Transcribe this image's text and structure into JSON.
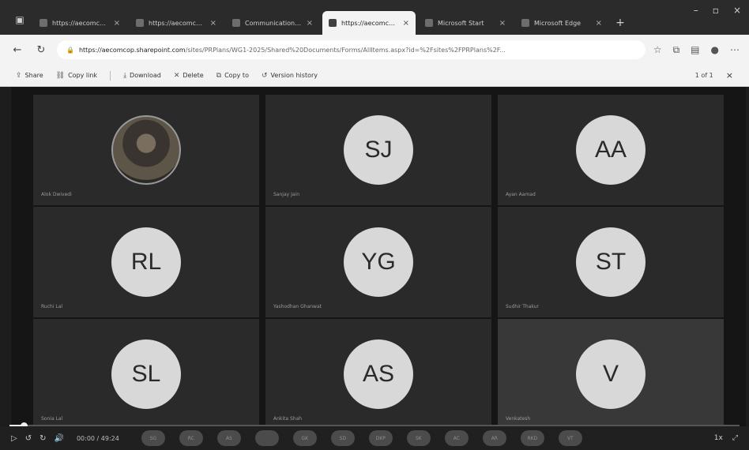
{
  "tabs": [
    {
      "label": "https://aecomcop.sharep",
      "active": false
    },
    {
      "label": "https://aecomcop.sharep",
      "active": false
    },
    {
      "label": "Communication site - Ur",
      "active": false
    },
    {
      "label": "https://aecomcop.sharep",
      "active": true
    },
    {
      "label": "Microsoft Start",
      "active": false
    },
    {
      "label": "Microsoft Edge",
      "active": false
    }
  ],
  "address": {
    "host": "https://aecomcop.sharepoint.com",
    "path": "/sites/PRPlans/WG1-2025/Shared%20Documents/Forms/AllItems.aspx?id=%2Fsites%2FPRPlans%2F..."
  },
  "pager": "1 of 1",
  "commands": [
    {
      "icon": "share-icon",
      "glyph": "⇪",
      "label": "Share"
    },
    {
      "icon": "link-icon",
      "glyph": "🔗",
      "label": "Copy link"
    },
    {
      "icon": "download-icon",
      "glyph": "⤓",
      "label": "Download"
    },
    {
      "icon": "delete-icon",
      "glyph": "🗑",
      "label": "Delete"
    },
    {
      "icon": "copy-icon",
      "glyph": "⧉",
      "label": "Copy to"
    },
    {
      "icon": "history-icon",
      "glyph": "↺",
      "label": "Version history"
    }
  ],
  "participants": [
    {
      "initials": "",
      "name": "Alok Dwivedi",
      "photo": true
    },
    {
      "initials": "SJ",
      "name": "Sanjay Jain",
      "photo": false
    },
    {
      "initials": "AA",
      "name": "Ayan Aamad",
      "photo": false
    },
    {
      "initials": "RL",
      "name": "Ruchi Lal",
      "photo": false
    },
    {
      "initials": "YG",
      "name": "Yashodhan Ghanwat",
      "photo": false
    },
    {
      "initials": "ST",
      "name": "Sudhir Thakur",
      "photo": false
    },
    {
      "initials": "SL",
      "name": "Sonia Lal",
      "photo": false
    },
    {
      "initials": "AS",
      "name": "Ankita Shah",
      "photo": false
    },
    {
      "initials": "V",
      "name": "Venkatesh",
      "photo": false
    }
  ],
  "player": {
    "time": "00:00 / 49:24",
    "speed": "1x",
    "progress": 0.02,
    "chips": [
      "SG",
      "RC",
      "AS",
      "",
      "GK",
      "SD",
      "DKP",
      "SK",
      "AC",
      "AR",
      "RKD",
      "VT"
    ]
  }
}
